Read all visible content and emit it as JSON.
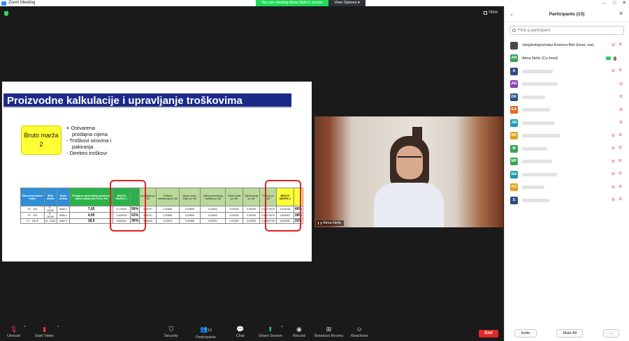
{
  "window": {
    "title": "Zoom Meeting"
  },
  "share_banner": {
    "viewing_text": "You are viewing Alma Nefic's screen",
    "view_options_label": "View Options ▾"
  },
  "meeting": {
    "view_label": "View"
  },
  "slide": {
    "title": "Proizvodne kalkulacije i upravljanje troškovima",
    "box_text": "Bruto marža 2",
    "bullets": [
      "= Ostvarena",
      "prodajna cijena",
      "- Troškovi sirovina i",
      "pakiranja",
      "- Direktni troškovi"
    ],
    "table": {
      "headers": [
        "Šifra proizvedene trojke",
        "Šifra artikla",
        "Naziv artikla",
        "Prodajna cijena (Neto ostvarena nakon rabata bez PDV), KM",
        "BRUTO MARŽA 1",
        "",
        "Ambalaža po JM",
        "Troškovi odvlaženja po JM",
        "Cijena vode i trojke po JM",
        "Cijena pomoćnog radnika po JM",
        "Cijena vode po JM",
        "Cijena struje po JM",
        "Prevoz po JM",
        "BRUTO MARŽA 2",
        ""
      ],
      "rows": [
        [
          "TC - 100",
          "P - 20200",
          "Artikl 1",
          "7,05",
          "4,176381",
          "59%",
          "0,15707",
          "0,20581",
          "0,03805",
          "0,02604",
          "0,00226",
          "0,00005",
          "0,51073075",
          "3,244348",
          "46%"
        ],
        [
          "TC - 100",
          "P - 20100",
          "Artikl 2",
          "4,95",
          "2,626416",
          "53%",
          "0,15707",
          "0,20581",
          "0,03805",
          "0,02604",
          "0,00226",
          "0,00005",
          "0,51073075",
          "1,844007",
          "38%"
        ],
        [
          "ZT - 100 Å",
          "M - 1043",
          "Artikl 3",
          "18,5",
          "6,634541",
          "36%",
          "0,18220",
          "0,23874",
          "0,00466",
          "0,03021",
          "0,00265",
          "0,00005",
          "0,50530746",
          "5,840532",
          "32%"
        ]
      ]
    }
  },
  "video": {
    "name": "Alma Nefic"
  },
  "participants": {
    "title": "Participants (13)",
    "search_placeholder": "Find a participant",
    "list": [
      {
        "initials": "",
        "name": "Vanjskotrgovinska Komora BiH (Host, me)",
        "color": "#4a4a4a",
        "blurred": false
      },
      {
        "initials": "AN",
        "name": "Alma Nefic (Co-host)",
        "color": "#3aa55a",
        "blurred": false
      },
      {
        "initials": "A",
        "name": "",
        "color": "#2f4f7f",
        "blurred": true
      },
      {
        "initials": "AD",
        "name": "",
        "color": "#8e3fb0",
        "blurred": true
      },
      {
        "initials": "DK",
        "name": "",
        "color": "#2f4f7f",
        "blurred": true
      },
      {
        "initials": "EA",
        "name": "",
        "color": "#e06b1f",
        "blurred": true
      },
      {
        "initials": "JM",
        "name": "",
        "color": "#1f9bb0",
        "blurred": true
      },
      {
        "initials": "MF",
        "name": "",
        "color": "#e0a01f",
        "blurred": true
      },
      {
        "initials": "M",
        "name": "",
        "color": "#3aa55a",
        "blurred": true
      },
      {
        "initials": "MP",
        "name": "",
        "color": "#3aa55a",
        "blurred": true
      },
      {
        "initials": "NA",
        "name": "",
        "color": "#1f9bb0",
        "blurred": true
      },
      {
        "initials": "NJ",
        "name": "",
        "color": "#e0a01f",
        "blurred": true
      },
      {
        "initials": "S",
        "name": "",
        "color": "#2f4f7f",
        "blurred": true
      }
    ],
    "invite_label": "Invite",
    "mute_all_label": "Mute All",
    "more_label": "..."
  },
  "toolbar": {
    "unmute": "Unmute",
    "start_video": "Start Video",
    "security": "Security",
    "participants": "Participants",
    "participants_count": "13",
    "chat": "Chat",
    "share_screen": "Share Screen",
    "record": "Record",
    "breakout_rooms": "Breakout Rooms",
    "reactions": "Reactions",
    "end": "End"
  }
}
